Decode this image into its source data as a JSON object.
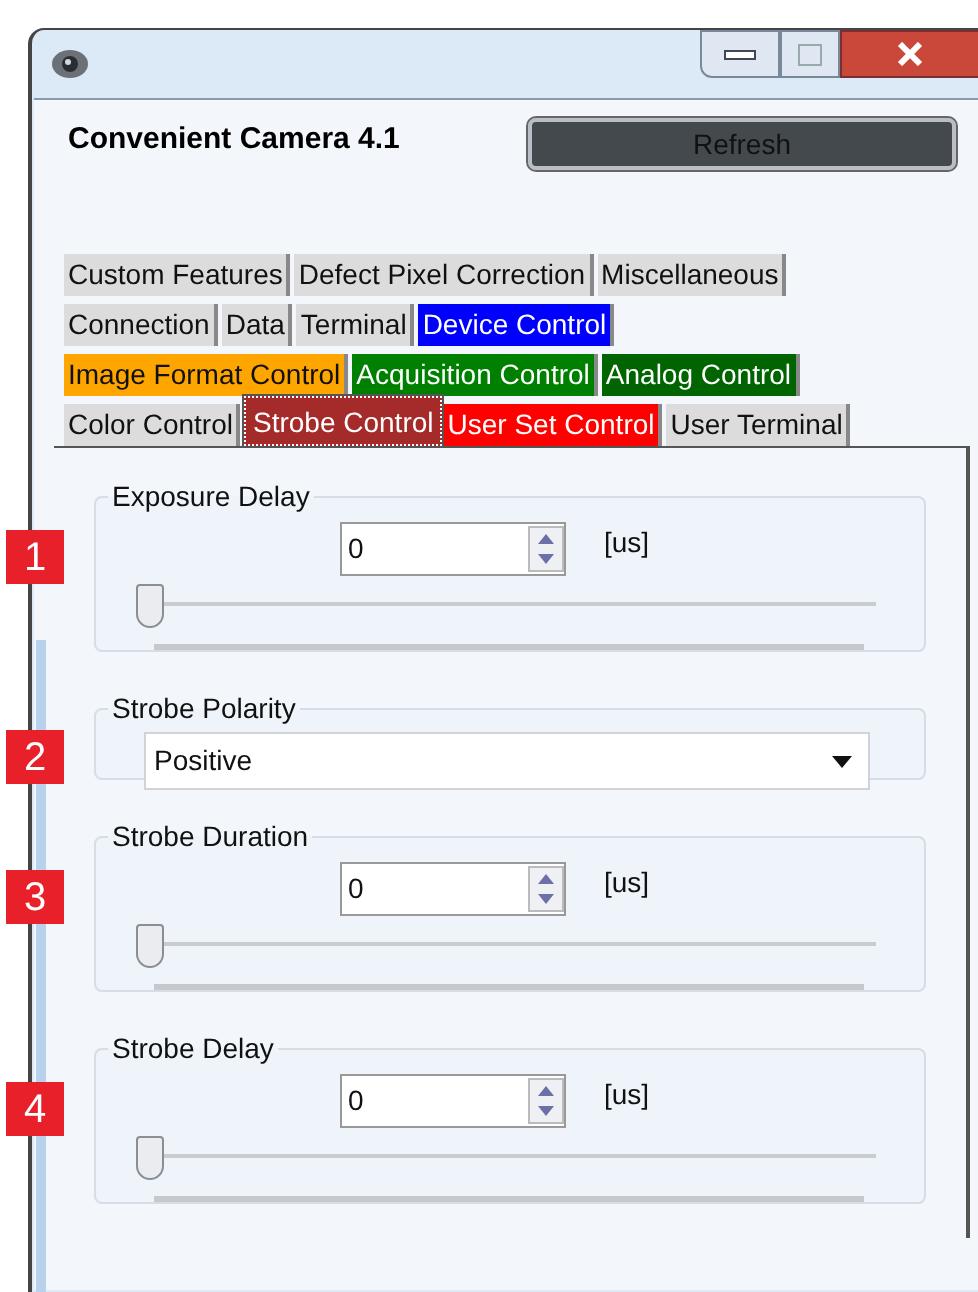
{
  "window": {
    "title": "Convenient Camera 4.1"
  },
  "refresh_button": "Refresh",
  "tab_rows": [
    {
      "tabs": [
        {
          "label": "Custom Features",
          "color": "#dcdcdc",
          "selected": false
        },
        {
          "label": "Defect Pixel Correction",
          "color": "#dcdcdc",
          "selected": false
        },
        {
          "label": "Miscellaneous",
          "color": "#dcdcdc",
          "selected": false
        }
      ]
    },
    {
      "tabs": [
        {
          "label": "Connection",
          "color": "#dcdcdc",
          "selected": false
        },
        {
          "label": "Data",
          "color": "#dcdcdc",
          "selected": false
        },
        {
          "label": "Terminal",
          "color": "#dcdcdc",
          "selected": false
        },
        {
          "label": "Device Control",
          "color": "#0000ff",
          "selected": false
        }
      ]
    },
    {
      "tabs": [
        {
          "label": "Image Format Control",
          "color": "#ffa500",
          "selected": false
        },
        {
          "label": "Acquisition Control",
          "color": "#008000",
          "selected": false
        },
        {
          "label": "Analog Control",
          "color": "#006400",
          "selected": false
        }
      ]
    },
    {
      "tabs": [
        {
          "label": "Color Control",
          "color": "#dcdcdc",
          "selected": false
        },
        {
          "label": "Strobe Control",
          "color": "#a52a2a",
          "selected": true
        },
        {
          "label": "User Set Control",
          "color": "#ff0000",
          "selected": false
        },
        {
          "label": "User Terminal",
          "color": "#dcdcdc",
          "selected": false
        }
      ]
    }
  ],
  "groups": [
    {
      "kind": "numeric",
      "callout": "1",
      "title": "Exposure Delay",
      "value": "0",
      "unit": "[us]",
      "level": 0
    },
    {
      "kind": "dropdown",
      "callout": "2",
      "title": "Strobe Polarity",
      "value": "Positive"
    },
    {
      "kind": "numeric",
      "callout": "3",
      "title": "Strobe Duration",
      "value": "0",
      "unit": "[us]",
      "level": 0
    },
    {
      "kind": "numeric",
      "callout": "4",
      "title": "Strobe Delay",
      "value": "0",
      "unit": "[us]",
      "level": 0
    }
  ]
}
